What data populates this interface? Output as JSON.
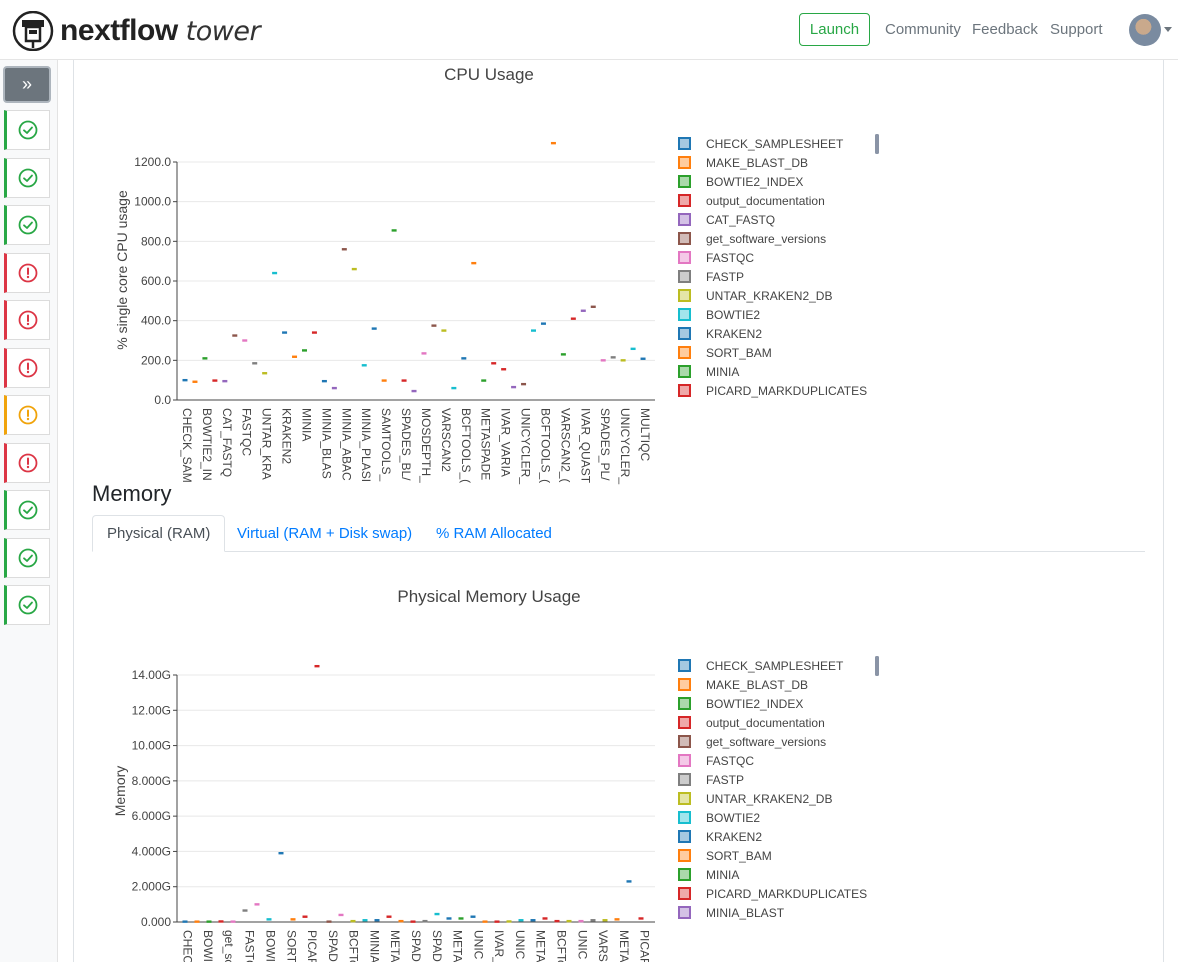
{
  "brand": {
    "name_bold": "nextflow",
    "name_italic": "tower"
  },
  "nav": {
    "launch_label": "Launch",
    "community": "Community",
    "feedback": "Feedback",
    "support": "Support"
  },
  "sidebar": {
    "expand_glyph": "»",
    "runs": [
      {
        "status": "success"
      },
      {
        "status": "success"
      },
      {
        "status": "success"
      },
      {
        "status": "failed"
      },
      {
        "status": "failed"
      },
      {
        "status": "failed"
      },
      {
        "status": "warning"
      },
      {
        "status": "failed"
      },
      {
        "status": "success"
      },
      {
        "status": "success"
      },
      {
        "status": "success"
      }
    ]
  },
  "colors": {
    "success": "#28a745",
    "failed": "#dc3545",
    "warning": "#f0a30a",
    "link": "#007bff"
  },
  "memory": {
    "heading": "Memory",
    "tabs": [
      {
        "label": "Physical (RAM)",
        "active": true
      },
      {
        "label": "Virtual (RAM + Disk swap)",
        "active": false
      },
      {
        "label": "% RAM Allocated",
        "active": false
      }
    ]
  },
  "chart_data": [
    {
      "type": "box",
      "title": "CPU Usage",
      "ylabel": "% single core CPU usage",
      "ylim": [
        0,
        1200
      ],
      "yticks": [
        "0.0",
        "200.0",
        "400.0",
        "600.0",
        "800.0",
        "1000.0",
        "1200.0"
      ],
      "categories": [
        "CHECK_SAM",
        "BOWTIE2_IN",
        "CAT_FASTQ",
        "FASTQC",
        "UNTAR_KRA",
        "KRAKEN2",
        "MINIA",
        "MINIA_BLAS",
        "MINIA_ABAC",
        "MINIA_PLASI",
        "SAMTOOLS_",
        "SPADES_BL/",
        "MOSDEPTH_",
        "VARSCAN2",
        "BCFTOOLS_(",
        "METASPADE",
        "IVAR_VARIA",
        "UNICYCLER_",
        "BCFTOOLS_(",
        "VARSCAN2_(",
        "IVAR_QUAST",
        "SPADES_PL/",
        "UNICYCLER_",
        "MULTIQC"
      ],
      "points": [
        {
          "s": 0,
          "v": 100
        },
        {
          "s": 1,
          "v": 92
        },
        {
          "s": 2,
          "v": 210
        },
        {
          "s": 3,
          "v": 98
        },
        {
          "s": 4,
          "v": 95
        },
        {
          "s": 5,
          "v": 325
        },
        {
          "s": 6,
          "v": 300
        },
        {
          "s": 7,
          "v": 185
        },
        {
          "s": 8,
          "v": 135
        },
        {
          "s": 9,
          "v": 640
        },
        {
          "s": 10,
          "v": 340
        },
        {
          "s": 11,
          "v": 218
        },
        {
          "s": 12,
          "v": 250
        },
        {
          "s": 13,
          "v": 340
        },
        {
          "s": 0,
          "v": 95
        },
        {
          "s": 4,
          "v": 60
        },
        {
          "s": 5,
          "v": 760
        },
        {
          "s": 8,
          "v": 660
        },
        {
          "s": 9,
          "v": 175
        },
        {
          "s": 0,
          "v": 360
        },
        {
          "s": 1,
          "v": 98
        },
        {
          "s": 2,
          "v": 855
        },
        {
          "s": 3,
          "v": 98
        },
        {
          "s": 4,
          "v": 45
        },
        {
          "s": 6,
          "v": 235
        },
        {
          "s": 5,
          "v": 375
        },
        {
          "s": 8,
          "v": 350
        },
        {
          "s": 9,
          "v": 60
        },
        {
          "s": 10,
          "v": 210
        },
        {
          "s": 1,
          "v": 690
        },
        {
          "s": 12,
          "v": 98
        },
        {
          "s": 3,
          "v": 185
        },
        {
          "s": 3,
          "v": 155
        },
        {
          "s": 4,
          "v": 65
        },
        {
          "s": 5,
          "v": 80
        },
        {
          "s": 9,
          "v": 350
        },
        {
          "s": 10,
          "v": 385
        },
        {
          "s": 1,
          "v": 1295
        },
        {
          "s": 12,
          "v": 230
        },
        {
          "s": 3,
          "v": 410
        },
        {
          "s": 4,
          "v": 450
        },
        {
          "s": 5,
          "v": 470
        },
        {
          "s": 6,
          "v": 200
        },
        {
          "s": 7,
          "v": 215
        },
        {
          "s": 8,
          "v": 200
        },
        {
          "s": 9,
          "v": 258
        },
        {
          "s": 10,
          "v": 208
        }
      ]
    },
    {
      "type": "box",
      "title": "Physical Memory Usage",
      "ylabel": "Memory",
      "ylim": [
        0,
        14
      ],
      "yticks": [
        "0.000",
        "2.000G",
        "4.000G",
        "6.000G",
        "8.000G",
        "10.00G",
        "12.00G",
        "14.00G"
      ],
      "categories": [
        "CHEC",
        "BOWI",
        "get_sc",
        "FASTC",
        "BOWI",
        "SORT",
        "PICAF",
        "SPAD",
        "BCFTo",
        "MINIA",
        "META",
        "SPAD",
        "SPAD",
        "META",
        "UNIC",
        "IVAR_",
        "UNIC",
        "META",
        "BCFTo",
        "UNIC",
        "VARS",
        "META",
        "PICAF"
      ],
      "points": [
        {
          "s": 0,
          "v": 0.02
        },
        {
          "s": 1,
          "v": 0.02
        },
        {
          "s": 2,
          "v": 0.02
        },
        {
          "s": 3,
          "v": 0.03
        },
        {
          "s": 5,
          "v": 0.02
        },
        {
          "s": 6,
          "v": 0.65
        },
        {
          "s": 5,
          "v": 1.0
        },
        {
          "s": 8,
          "v": 0.15
        },
        {
          "s": 9,
          "v": 3.9
        },
        {
          "s": 10,
          "v": 0.15
        },
        {
          "s": 12,
          "v": 0.3
        },
        {
          "s": 3,
          "v": 14.5
        },
        {
          "s": 4,
          "v": 0.02
        },
        {
          "s": 5,
          "v": 0.4
        },
        {
          "s": 7,
          "v": 0.05
        },
        {
          "s": 8,
          "v": 0.1
        },
        {
          "s": 9,
          "v": 0.1
        },
        {
          "s": 12,
          "v": 0.3
        },
        {
          "s": 10,
          "v": 0.05
        },
        {
          "s": 3,
          "v": 0.02
        },
        {
          "s": 6,
          "v": 0.05
        },
        {
          "s": 8,
          "v": 0.45
        },
        {
          "s": 9,
          "v": 0.2
        },
        {
          "s": 11,
          "v": 0.2
        },
        {
          "s": 0,
          "v": 0.3
        },
        {
          "s": 1,
          "v": 0.02
        },
        {
          "s": 3,
          "v": 0.02
        },
        {
          "s": 7,
          "v": 0.03
        },
        {
          "s": 8,
          "v": 0.1
        },
        {
          "s": 9,
          "v": 0.1
        },
        {
          "s": 12,
          "v": 0.2
        },
        {
          "s": 3,
          "v": 0.05
        },
        {
          "s": 7,
          "v": 0.05
        },
        {
          "s": 5,
          "v": 0.05
        },
        {
          "s": 6,
          "v": 0.1
        },
        {
          "s": 7,
          "v": 0.1
        },
        {
          "s": 10,
          "v": 0.15
        },
        {
          "s": 9,
          "v": 2.3
        },
        {
          "s": 12,
          "v": 0.2
        }
      ]
    }
  ],
  "legends": [
    [
      "CHECK_SAMPLESHEET",
      "MAKE_BLAST_DB",
      "BOWTIE2_INDEX",
      "output_documentation",
      "CAT_FASTQ",
      "get_software_versions",
      "FASTQC",
      "FASTP",
      "UNTAR_KRAKEN2_DB",
      "BOWTIE2",
      "KRAKEN2",
      "SORT_BAM",
      "MINIA",
      "PICARD_MARKDUPLICATES"
    ],
    [
      "CHECK_SAMPLESHEET",
      "MAKE_BLAST_DB",
      "BOWTIE2_INDEX",
      "output_documentation",
      "get_software_versions",
      "FASTQC",
      "FASTP",
      "UNTAR_KRAKEN2_DB",
      "BOWTIE2",
      "KRAKEN2",
      "SORT_BAM",
      "MINIA",
      "PICARD_MARKDUPLICATES",
      "MINIA_BLAST"
    ]
  ],
  "palettes": [
    [
      "#1f77b4",
      "#ff7f0e",
      "#2ca02c",
      "#d62728",
      "#9467bd",
      "#8c564b",
      "#e377c2",
      "#7f7f7f",
      "#bcbd22",
      "#17becf",
      "#1f77b4",
      "#ff7f0e",
      "#2ca02c",
      "#d62728"
    ],
    [
      "#1f77b4",
      "#ff7f0e",
      "#2ca02c",
      "#d62728",
      "#8c564b",
      "#e377c2",
      "#7f7f7f",
      "#bcbd22",
      "#17becf",
      "#1f77b4",
      "#ff7f0e",
      "#2ca02c",
      "#d62728",
      "#9467bd"
    ]
  ]
}
